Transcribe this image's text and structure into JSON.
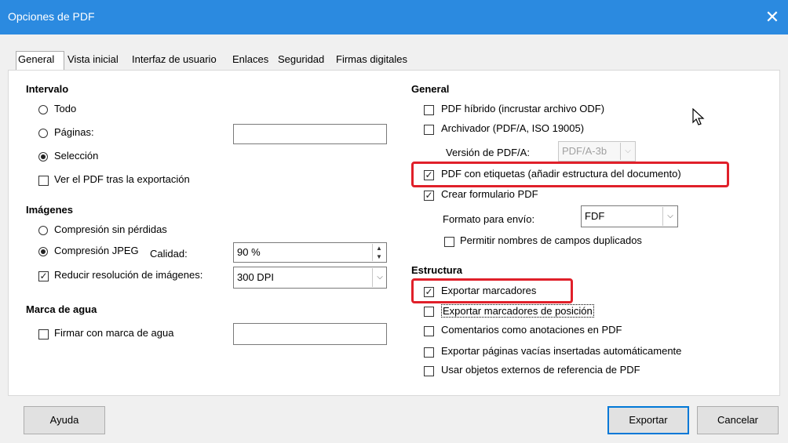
{
  "window": {
    "title": "Opciones de PDF",
    "close_label": "✕"
  },
  "tabs": [
    "General",
    "Vista inicial",
    "Interfaz de usuario",
    "Enlaces",
    "Seguridad",
    "Firmas digitales"
  ],
  "intervalo": {
    "heading": "Intervalo",
    "todo": "Todo",
    "paginas": "Páginas:",
    "paginas_value": "",
    "seleccion": "Selección",
    "ver_pdf": "Ver el PDF tras la exportación"
  },
  "imagenes": {
    "heading": "Imágenes",
    "sin_perdidas": "Compresión sin pérdidas",
    "jpeg": "Compresión JPEG",
    "calidad_label": "Calidad:",
    "calidad_value": "90 %",
    "reducir": "Reducir resolución de imágenes:",
    "dpi_value": "300 DPI"
  },
  "marca": {
    "heading": "Marca de agua",
    "firmar": "Firmar con marca de agua",
    "firmar_value": ""
  },
  "general": {
    "heading": "General",
    "hibrido": "PDF híbrido (incrustar archivo ODF)",
    "archivador": "Archivador (PDF/A, ISO 19005)",
    "version_label": "Versión de PDF/A:",
    "version_value": "PDF/A-3b",
    "etiquetas": "PDF con etiquetas (añadir estructura del documento)",
    "formulario": "Crear formulario PDF",
    "formato_label": "Formato para envío:",
    "formato_value": "FDF",
    "permitir": "Permitir nombres de campos duplicados"
  },
  "estructura": {
    "heading": "Estructura",
    "marcadores": "Exportar marcadores",
    "marcadores_pos": "Exportar marcadores de posición",
    "comentarios": "Comentarios como anotaciones en PDF",
    "paginas_vacias": "Exportar páginas vacías insertadas automáticamente",
    "objetos": "Usar objetos externos de referencia de PDF"
  },
  "buttons": {
    "ayuda": "Ayuda",
    "exportar": "Exportar",
    "cancelar": "Cancelar"
  },
  "colors": {
    "titlebar": "#2b8ae0",
    "highlight": "#e0202a",
    "primary_border": "#0078d7"
  }
}
